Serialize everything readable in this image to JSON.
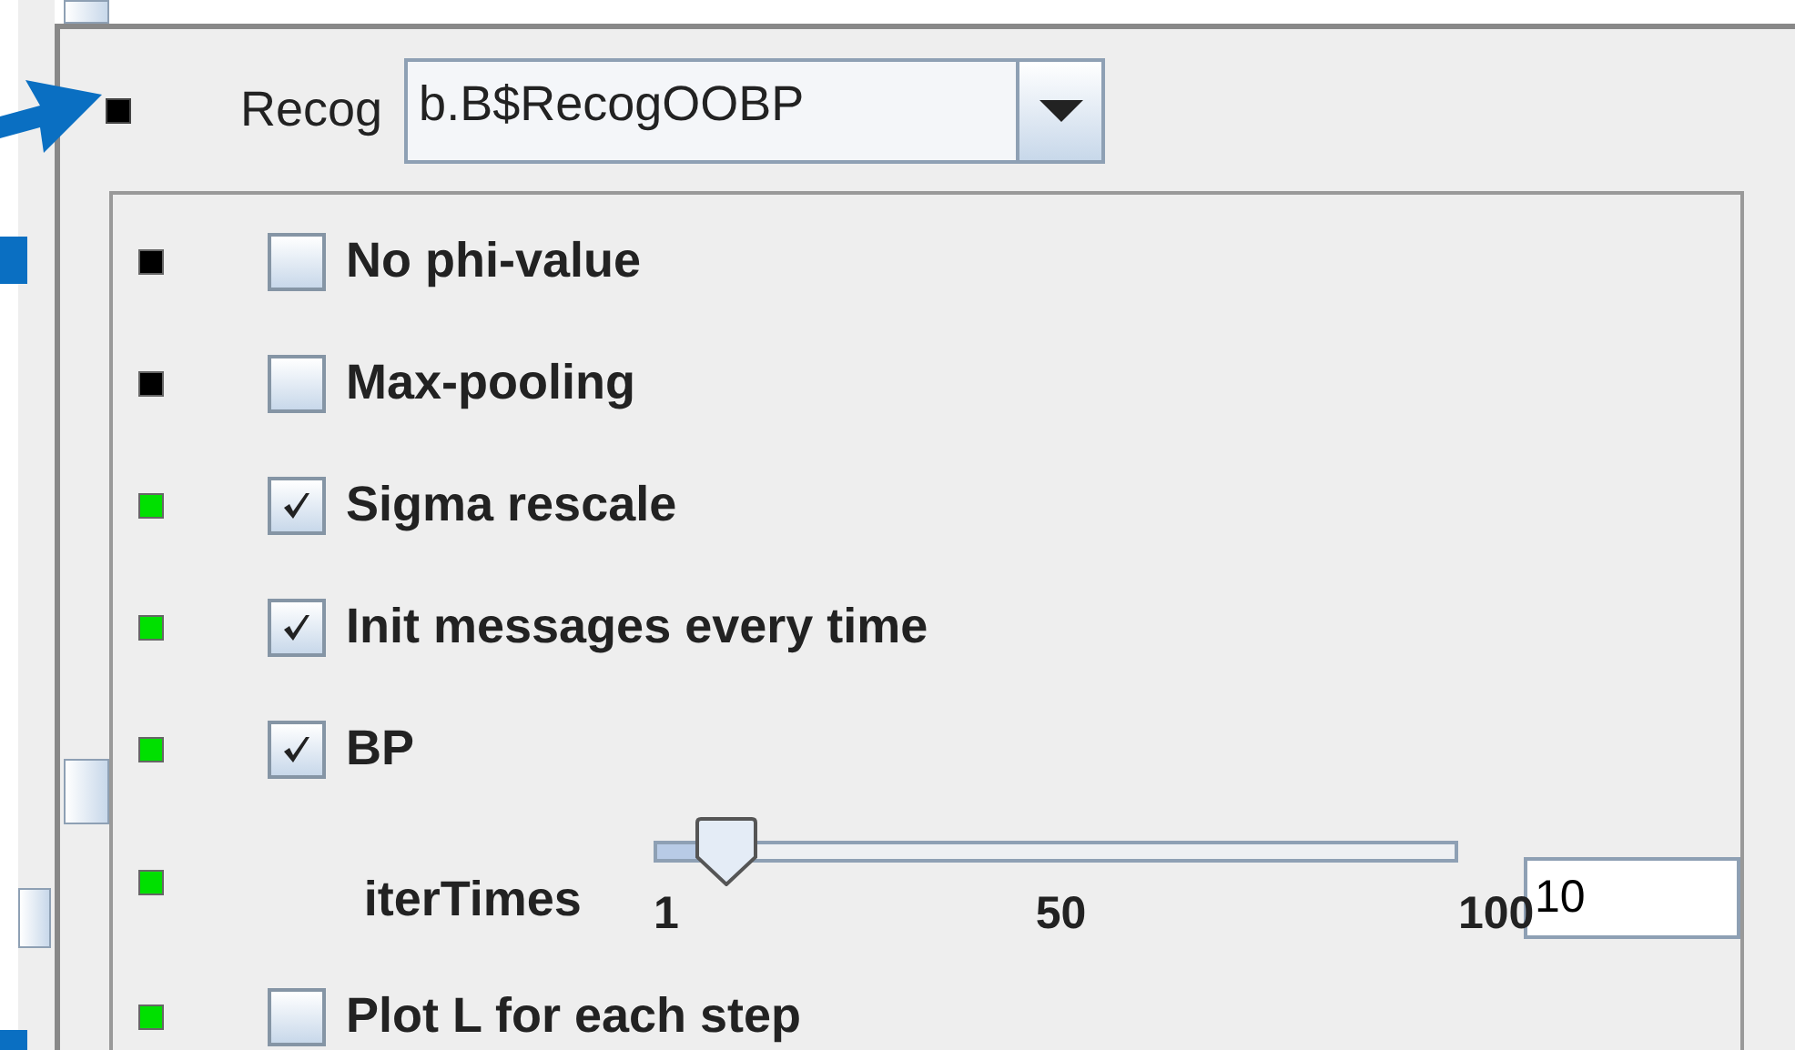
{
  "recog": {
    "color": "#000000",
    "label": "Recog",
    "value": "b.B$RecogOOBP"
  },
  "options": [
    {
      "kind": "checkbox",
      "color": "#000000",
      "label": "No phi-value",
      "checked": false
    },
    {
      "kind": "checkbox",
      "color": "#000000",
      "label": "Max-pooling",
      "checked": false
    },
    {
      "kind": "checkbox",
      "color": "#00e000",
      "label": "Sigma rescale",
      "checked": true
    },
    {
      "kind": "checkbox",
      "color": "#00e000",
      "label": "Init messages every time",
      "checked": true
    },
    {
      "kind": "checkbox",
      "color": "#00e000",
      "label": "BP",
      "checked": true
    },
    {
      "kind": "slider",
      "color": "#00e000",
      "label": "iterTimes",
      "level": 0.09,
      "ticks": [
        "1",
        "50",
        "100"
      ],
      "value": "10"
    },
    {
      "kind": "checkbox",
      "color": "#00e000",
      "label": "Plot L for each step",
      "checked": false
    }
  ]
}
